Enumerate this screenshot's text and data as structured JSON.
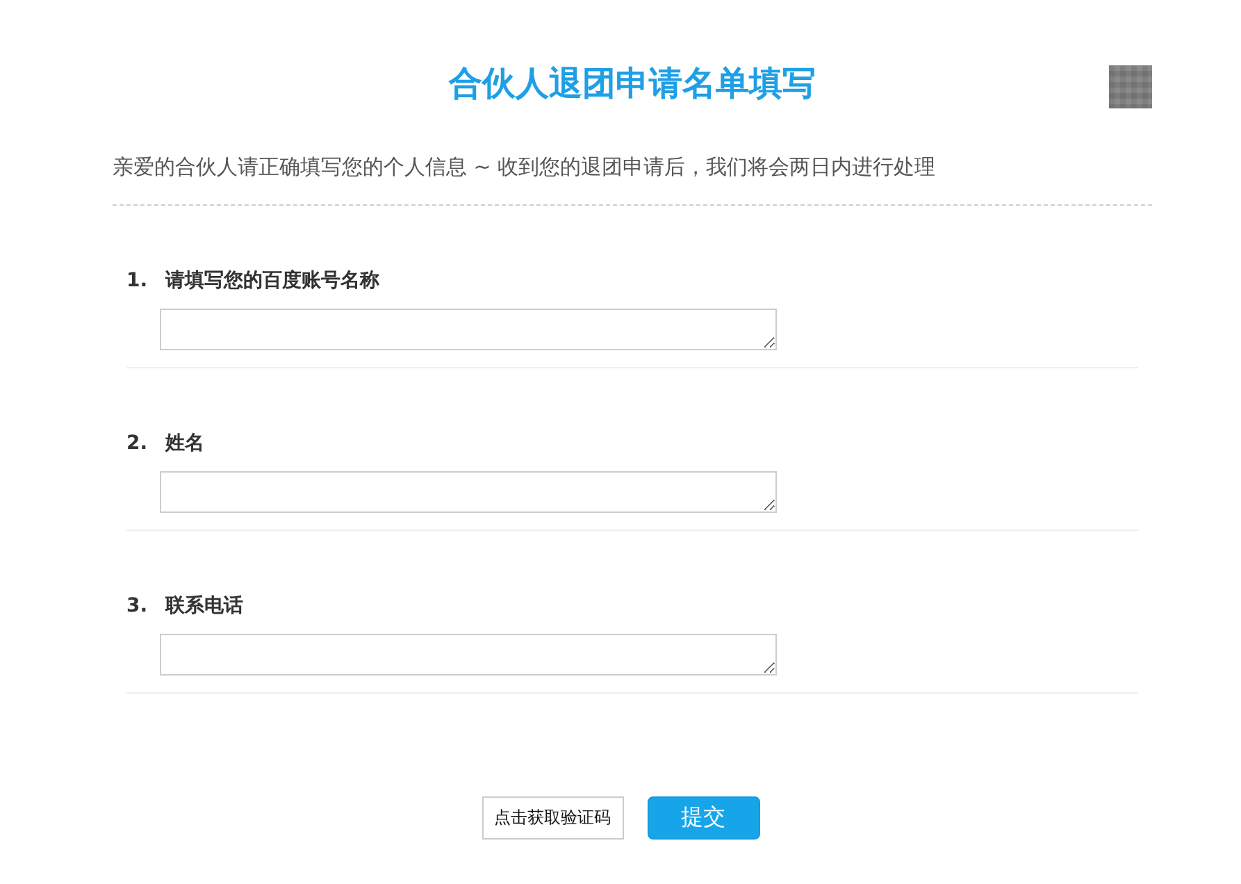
{
  "title": "合伙人退团申请名单填写",
  "intro": "亲爱的合伙人请正确填写您的个人信息 ~ 收到您的退团申请后，我们将会两日内进行处理",
  "questions": [
    {
      "number": "1.",
      "label": "请填写您的百度账号名称"
    },
    {
      "number": "2.",
      "label": "姓名"
    },
    {
      "number": "3.",
      "label": "联系电话"
    }
  ],
  "actions": [
    {
      "kind": "secondary",
      "label": "点击获取验证码"
    },
    {
      "kind": "primary",
      "label": "提交"
    }
  ]
}
